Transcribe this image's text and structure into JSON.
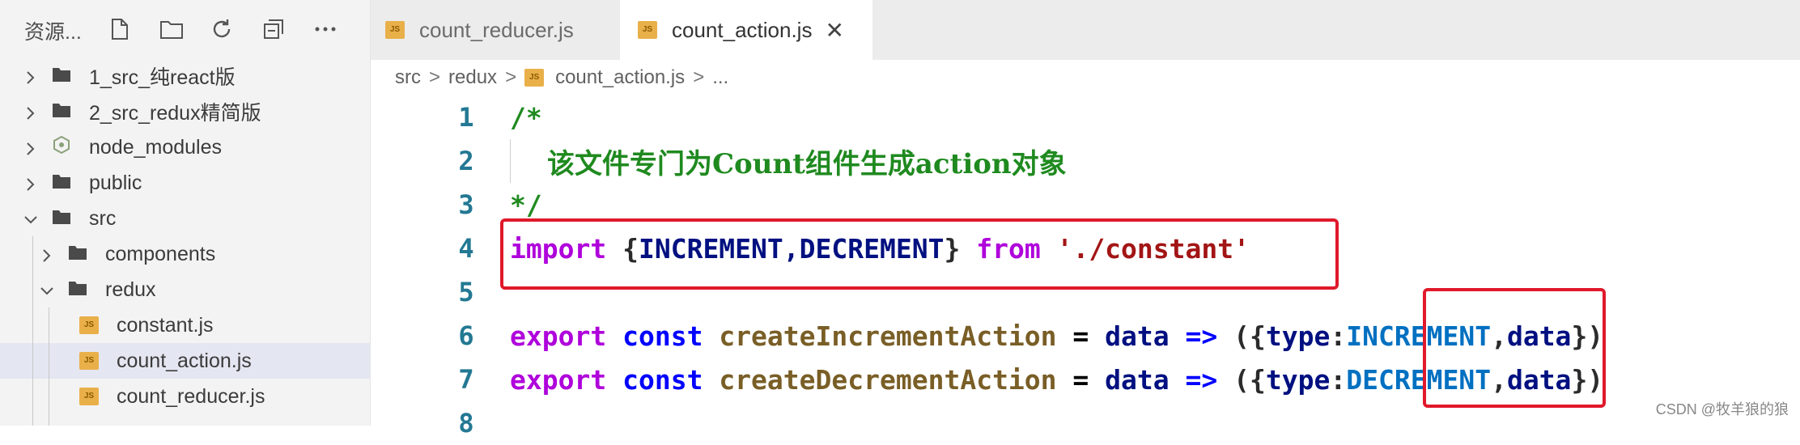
{
  "sidebar": {
    "title": "资源...",
    "tree": [
      {
        "label": "1_src_纯react版",
        "kind": "folder",
        "expanded": false
      },
      {
        "label": "2_src_redux精简版",
        "kind": "folder",
        "expanded": false
      },
      {
        "label": "node_modules",
        "kind": "node-modules",
        "expanded": false
      },
      {
        "label": "public",
        "kind": "folder",
        "expanded": false
      },
      {
        "label": "src",
        "kind": "folder",
        "expanded": true
      },
      {
        "label": "components",
        "kind": "folder",
        "expanded": false
      },
      {
        "label": "redux",
        "kind": "folder",
        "expanded": true
      },
      {
        "label": "constant.js",
        "kind": "js"
      },
      {
        "label": "count_action.js",
        "kind": "js",
        "selected": true
      },
      {
        "label": "count_reducer.js",
        "kind": "js"
      }
    ]
  },
  "tabs": [
    {
      "label": "count_reducer.js",
      "active": false
    },
    {
      "label": "count_action.js",
      "active": true,
      "close": "✕"
    }
  ],
  "breadcrumb": {
    "parts": [
      "src",
      "redux",
      "count_action.js",
      "..."
    ],
    "sep": ">"
  },
  "editor": {
    "line_numbers": [
      "1",
      "2",
      "3",
      "4",
      "5",
      "6",
      "7",
      "8"
    ],
    "line1": "/*",
    "line2": "该文件专门为Count组件生成action对象",
    "line3": "*/",
    "line4": {
      "kw_import": "import",
      "brace_open": "{",
      "names": "INCREMENT,DECREMENT",
      "brace_close": "}",
      "kw_from": "from",
      "path": "'./constant'"
    },
    "line6": {
      "kw_export": "export",
      "kw_const": "const",
      "fn": "createIncrementAction",
      "eq": "=",
      "param": "data",
      "arrow": "=>",
      "open": "({",
      "type_key": "type",
      "colon": ":",
      "value": "INCREMENT",
      "tail_comma": ",",
      "tail_data": "data",
      "close": "})"
    },
    "line7": {
      "kw_export": "export",
      "kw_const": "const",
      "fn": "createDecrementAction",
      "eq": "=",
      "param": "data",
      "arrow": "=>",
      "open": "({",
      "type_key": "type",
      "colon": ":",
      "value": "DECREMENT",
      "tail_comma": ",",
      "tail_data": "data",
      "close": "})"
    }
  },
  "watermark": "CSDN @牧羊狼的狼",
  "colors": {
    "highlight_box": "#e0192b",
    "line_number": "#237893",
    "comment": "#1f8a1f"
  }
}
